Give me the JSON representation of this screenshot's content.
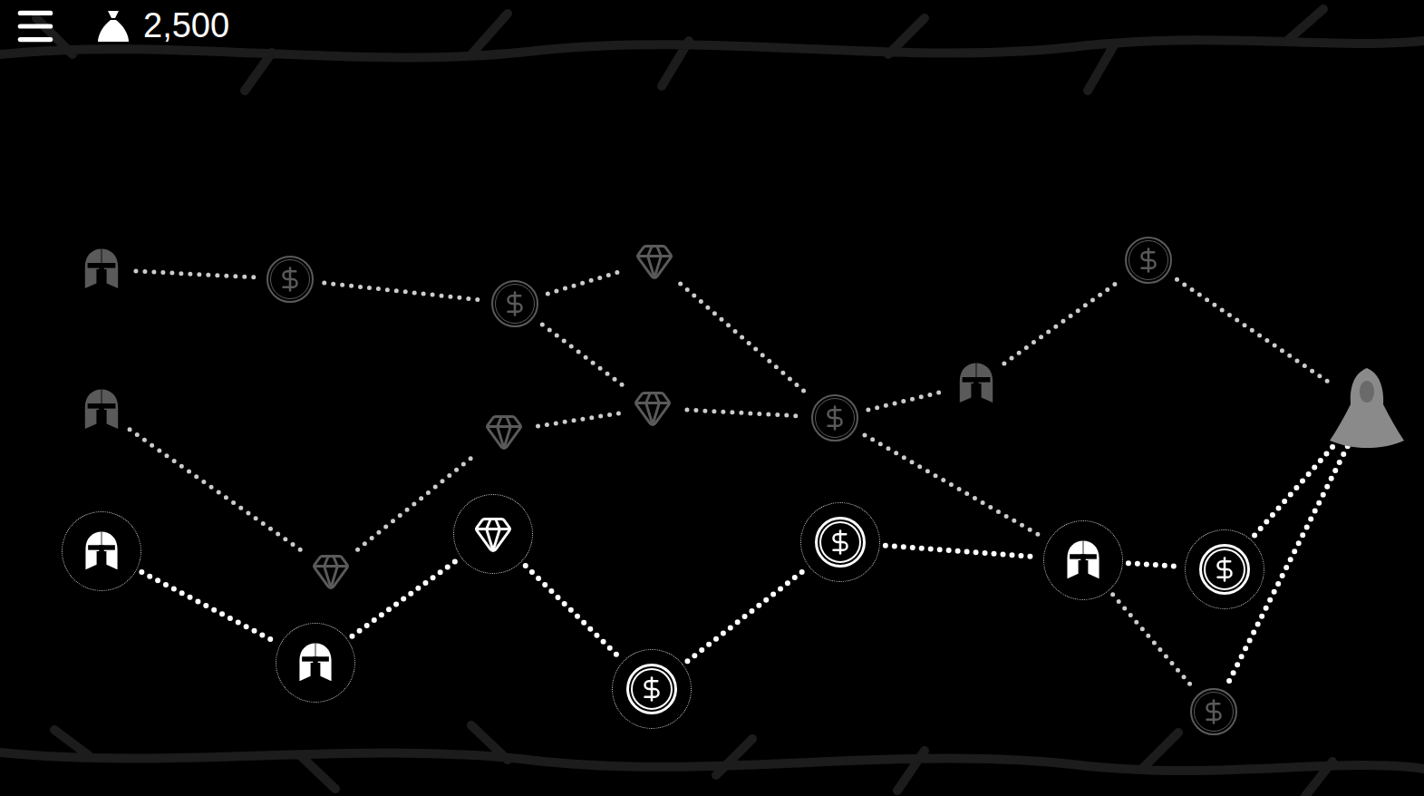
{
  "header": {
    "gold": "2,500"
  },
  "map": {
    "nodes": [
      {
        "kind": "battle",
        "reachable": false
      },
      {
        "kind": "coin",
        "reachable": false
      },
      {
        "kind": "coin",
        "reachable": false
      },
      {
        "kind": "gem",
        "reachable": false
      },
      {
        "kind": "battle",
        "reachable": false
      },
      {
        "kind": "gem",
        "reachable": false
      },
      {
        "kind": "gem",
        "reachable": false
      },
      {
        "kind": "coin",
        "reachable": false
      },
      {
        "kind": "battle",
        "reachable": false
      },
      {
        "kind": "coin",
        "reachable": false
      },
      {
        "kind": "boss",
        "reachable": false
      },
      {
        "kind": "battle",
        "reachable": true
      },
      {
        "kind": "gem",
        "reachable": false
      },
      {
        "kind": "battle",
        "reachable": true
      },
      {
        "kind": "gem",
        "reachable": true
      },
      {
        "kind": "coin",
        "reachable": true
      },
      {
        "kind": "coin",
        "reachable": true
      },
      {
        "kind": "battle",
        "reachable": true
      },
      {
        "kind": "coin",
        "reachable": true
      },
      {
        "kind": "coin",
        "reachable": false
      }
    ],
    "edges": [
      {
        "from": 0,
        "to": 1,
        "active": false
      },
      {
        "from": 1,
        "to": 2,
        "active": false
      },
      {
        "from": 2,
        "to": 3,
        "active": false
      },
      {
        "from": 2,
        "to": 6,
        "active": false
      },
      {
        "from": 3,
        "to": 7,
        "active": false
      },
      {
        "from": 4,
        "to": 12,
        "active": false
      },
      {
        "from": 12,
        "to": 5,
        "active": false
      },
      {
        "from": 5,
        "to": 6,
        "active": false
      },
      {
        "from": 6,
        "to": 7,
        "active": false
      },
      {
        "from": 7,
        "to": 8,
        "active": false
      },
      {
        "from": 8,
        "to": 9,
        "active": false
      },
      {
        "from": 9,
        "to": 10,
        "active": false
      },
      {
        "from": 7,
        "to": 17,
        "active": false
      },
      {
        "from": 11,
        "to": 13,
        "active": true
      },
      {
        "from": 13,
        "to": 14,
        "active": true
      },
      {
        "from": 14,
        "to": 15,
        "active": true
      },
      {
        "from": 15,
        "to": 16,
        "active": true
      },
      {
        "from": 16,
        "to": 17,
        "active": true
      },
      {
        "from": 17,
        "to": 18,
        "active": true
      },
      {
        "from": 18,
        "to": 10,
        "active": true
      },
      {
        "from": 17,
        "to": 19,
        "active": false
      },
      {
        "from": 19,
        "to": 10,
        "active": true
      }
    ]
  }
}
